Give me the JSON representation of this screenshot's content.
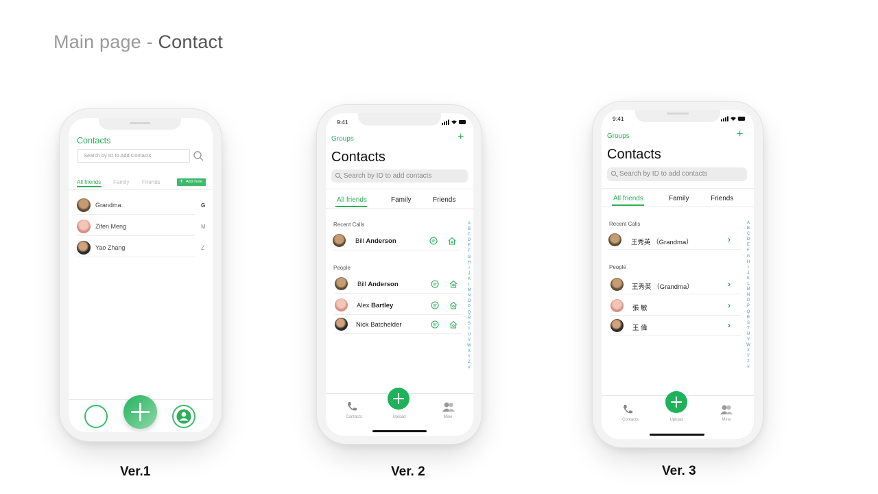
{
  "slide": {
    "title_prefix": "Main page - ",
    "title_highlight": "Contact"
  },
  "labels": {
    "v1": "Ver.1",
    "v2": "Ver. 2",
    "v3": "Ver. 3"
  },
  "colors": {
    "accent": "#2dae5a",
    "index": "#4a90d9"
  },
  "v1": {
    "title": "Contacts",
    "search_placeholder": "Search by ID to Add Contacts",
    "tabs": [
      "All friends",
      "Family",
      "Friends"
    ],
    "add_more": "Add more",
    "contacts": [
      {
        "name": "Grandma",
        "index": "G"
      },
      {
        "name": "Zifen Meng",
        "index": "M"
      },
      {
        "name": "Yao Zhang",
        "index": "Z"
      }
    ]
  },
  "v2": {
    "time": "9:41",
    "groups": "Groups",
    "title": "Contacts",
    "search_placeholder": "Search by ID to add contacts",
    "tabs": [
      "All friends",
      "Family",
      "Friends"
    ],
    "recent_label": "Recent Calls",
    "recent": [
      {
        "first": "Bill",
        "last": "Anderson"
      }
    ],
    "people_label": "People",
    "people": [
      {
        "first": "Bill",
        "last": "Anderson"
      },
      {
        "first": "Alex",
        "last": "Bartley"
      },
      {
        "first": "Nick",
        "last": "Batchelder"
      }
    ],
    "alphabet": [
      "A",
      "B",
      "C",
      "D",
      "E",
      "F",
      "G",
      "H",
      "I",
      "J",
      "K",
      "L",
      "M",
      "N",
      "O",
      "P",
      "Q",
      "R",
      "S",
      "T",
      "U",
      "V",
      "W",
      "X",
      "Y",
      "Z",
      "#"
    ],
    "tabbar": [
      "Contacts",
      "Upload",
      "Mine"
    ]
  },
  "v3": {
    "time": "9:41",
    "groups": "Groups",
    "title": "Contacts",
    "search_placeholder": "Search by ID to add contacts",
    "tabs": [
      "All friends",
      "Family",
      "Friends"
    ],
    "recent_label": "Recent Calls",
    "recent": [
      {
        "name": "王秀英 （Grandma）"
      }
    ],
    "people_label": "People",
    "people": [
      {
        "name": "王秀英 （Grandma）"
      },
      {
        "name": "張 敏"
      },
      {
        "name": "王 偉"
      }
    ],
    "alphabet": [
      "A",
      "B",
      "C",
      "D",
      "E",
      "F",
      "G",
      "H",
      "I",
      "J",
      "K",
      "L",
      "M",
      "N",
      "O",
      "P",
      "Q",
      "R",
      "S",
      "T",
      "U",
      "V",
      "W",
      "X",
      "Y",
      "Z",
      "#"
    ],
    "tabbar": [
      "Contacts",
      "Upload",
      "Mine"
    ]
  }
}
